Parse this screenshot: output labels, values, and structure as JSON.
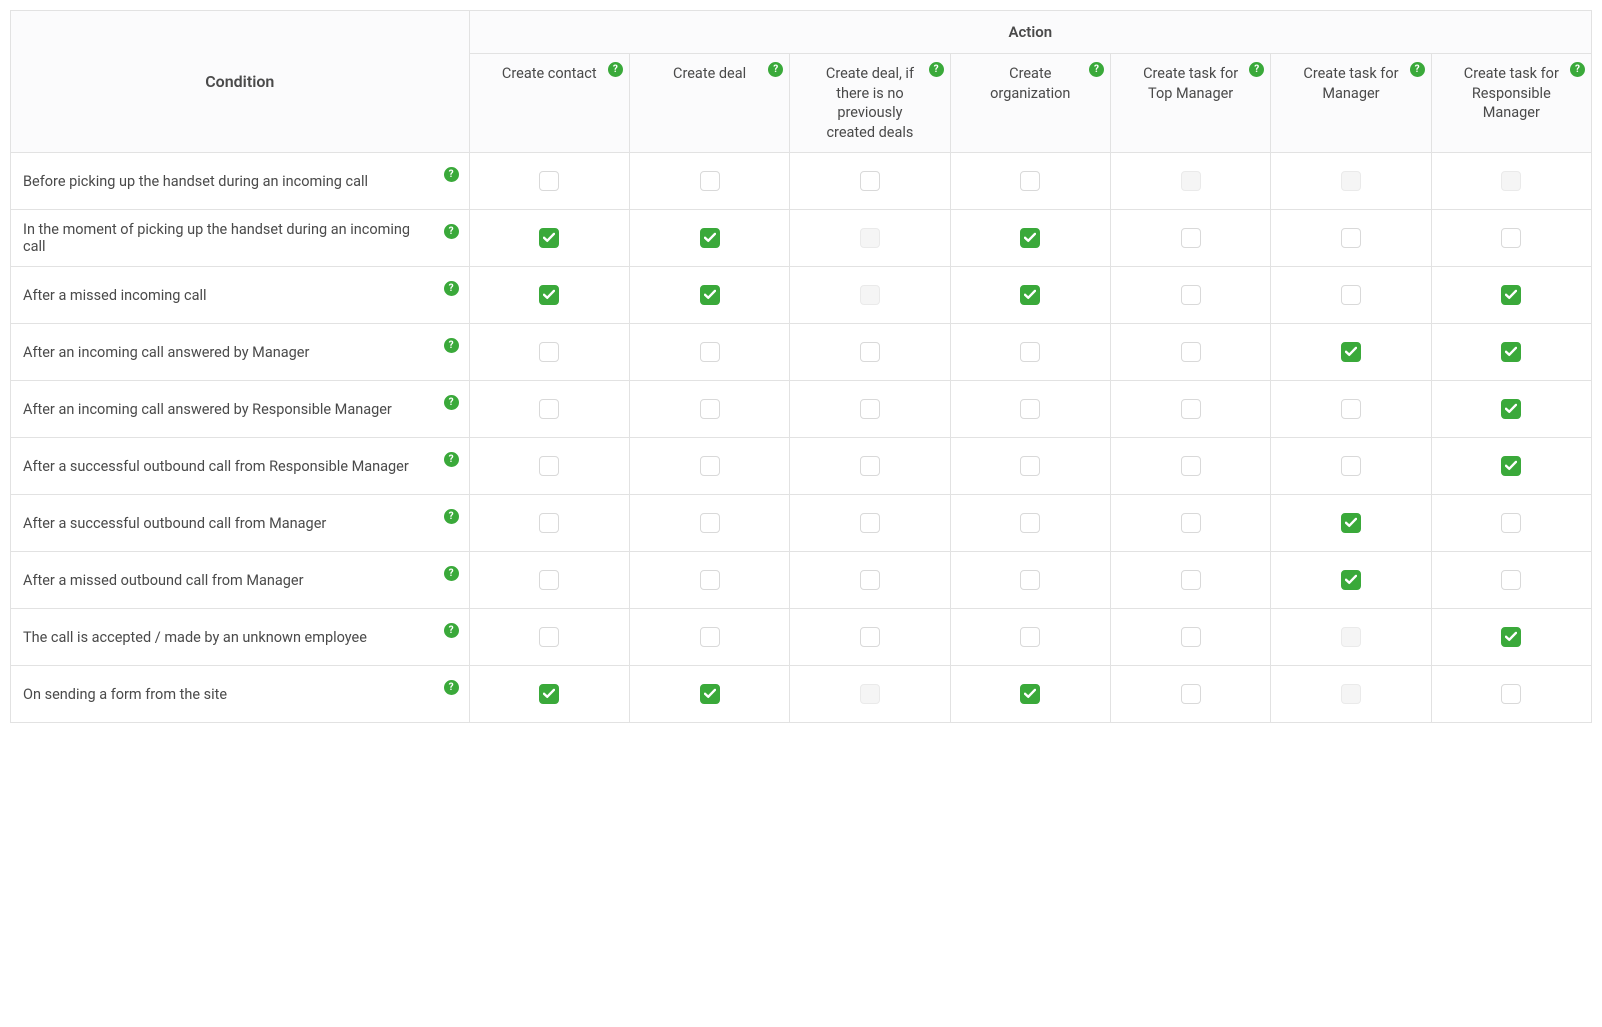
{
  "headers": {
    "condition": "Condition",
    "action_group": "Action"
  },
  "actions": [
    {
      "id": "create-contact",
      "label": "Create contact"
    },
    {
      "id": "create-deal",
      "label": "Create deal"
    },
    {
      "id": "create-deal-if-none",
      "label": "Create deal, if there is no previously created deals"
    },
    {
      "id": "create-organization",
      "label": "Create organization"
    },
    {
      "id": "create-task-top-manager",
      "label": "Create task for Top Manager"
    },
    {
      "id": "create-task-manager",
      "label": "Create task for Manager"
    },
    {
      "id": "create-task-responsible-manager",
      "label": "Create task for Responsible Manager"
    }
  ],
  "rows": [
    {
      "id": "before-pickup-incoming",
      "label": "Before picking up the handset during an incoming call",
      "cells": [
        "unchecked",
        "unchecked",
        "unchecked",
        "unchecked",
        "disabled",
        "disabled",
        "disabled"
      ]
    },
    {
      "id": "moment-pickup-incoming",
      "label": "In the moment of picking up the handset during an incoming call",
      "cells": [
        "checked",
        "checked",
        "disabled",
        "checked",
        "unchecked",
        "unchecked",
        "unchecked"
      ]
    },
    {
      "id": "after-missed-incoming",
      "label": "After a missed incoming call",
      "cells": [
        "checked",
        "checked",
        "disabled",
        "checked",
        "unchecked",
        "unchecked",
        "checked"
      ]
    },
    {
      "id": "after-incoming-answered-manager",
      "label": "After an incoming call answered by Manager",
      "cells": [
        "unchecked",
        "unchecked",
        "unchecked",
        "unchecked",
        "unchecked",
        "checked",
        "checked"
      ]
    },
    {
      "id": "after-incoming-answered-responsible",
      "label": "After an incoming call answered by Responsible Manager",
      "cells": [
        "unchecked",
        "unchecked",
        "unchecked",
        "unchecked",
        "unchecked",
        "unchecked",
        "checked"
      ]
    },
    {
      "id": "after-successful-outbound-responsible",
      "label": "After a successful outbound call from Responsible Manager",
      "cells": [
        "unchecked",
        "unchecked",
        "unchecked",
        "unchecked",
        "unchecked",
        "unchecked",
        "checked"
      ]
    },
    {
      "id": "after-successful-outbound-manager",
      "label": "After a successful outbound call from Manager",
      "cells": [
        "unchecked",
        "unchecked",
        "unchecked",
        "unchecked",
        "unchecked",
        "checked",
        "unchecked"
      ]
    },
    {
      "id": "after-missed-outbound-manager",
      "label": "After a missed outbound call from Manager",
      "cells": [
        "unchecked",
        "unchecked",
        "unchecked",
        "unchecked",
        "unchecked",
        "checked",
        "unchecked"
      ]
    },
    {
      "id": "call-unknown-employee",
      "label": "The call is accepted / made by an unknown employee",
      "cells": [
        "unchecked",
        "unchecked",
        "unchecked",
        "unchecked",
        "unchecked",
        "disabled",
        "checked"
      ]
    },
    {
      "id": "on-sending-form",
      "label": "On sending a form from the site",
      "cells": [
        "checked",
        "checked",
        "disabled",
        "checked",
        "unchecked",
        "disabled",
        "unchecked"
      ]
    }
  ]
}
